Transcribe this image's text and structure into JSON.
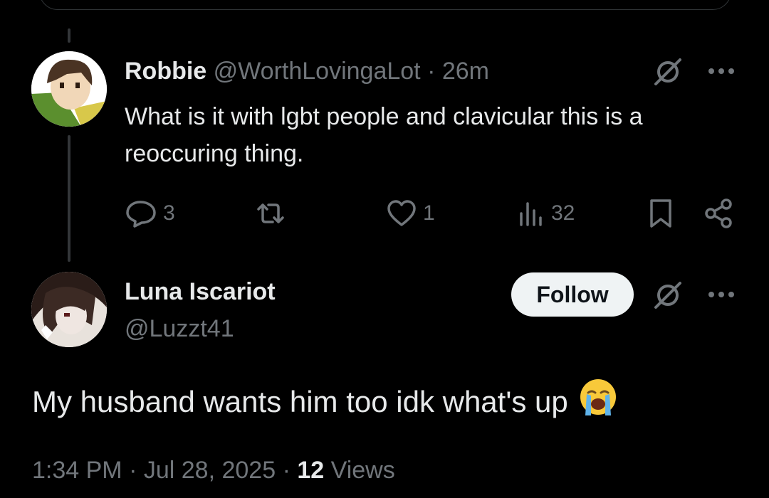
{
  "reply": {
    "author_name": "Robbie",
    "handle": "@WorthLovingaLot",
    "separator": "·",
    "time": "26m",
    "text": "What is it with lgbt people and clavicular this is a reoccuring thing.",
    "stats": {
      "replies": "3",
      "retweets": "",
      "likes": "1",
      "views": "32"
    }
  },
  "main": {
    "author_name": "Luna Iscariot",
    "handle": "@Luzzt41",
    "follow_label": "Follow",
    "text": "My husband wants him too idk what's up",
    "emoji": "crying-face",
    "time": "1:34 PM",
    "sep1": "·",
    "date": "Jul 28, 2025",
    "sep2": "·",
    "views_count": "12",
    "views_label": "Views"
  },
  "icons": [
    "grok-icon",
    "more-icon",
    "reply-icon",
    "retweet-icon",
    "like-icon",
    "views-icon",
    "bookmark-icon",
    "share-icon"
  ],
  "colors": {
    "background": "#000000",
    "text": "#e7e9ea",
    "muted": "#71767b",
    "follow_bg": "#eff3f4",
    "follow_text": "#0f1419"
  }
}
